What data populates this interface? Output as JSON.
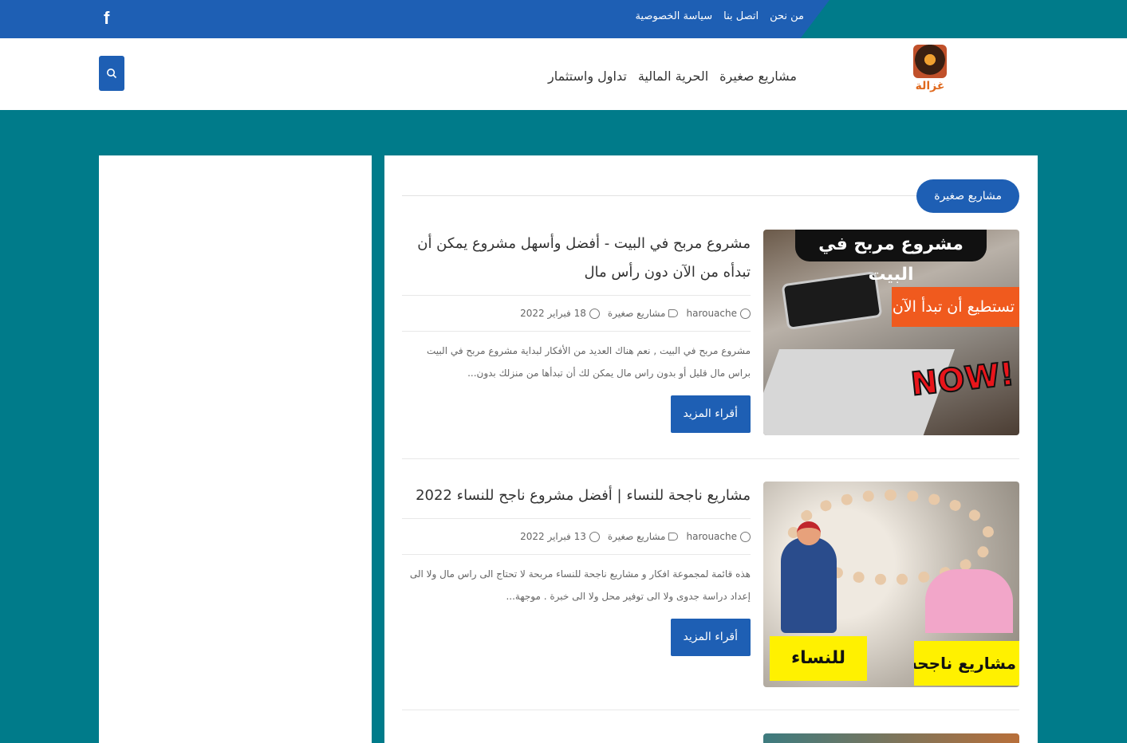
{
  "topbar": {
    "links": [
      "سياسة الخصوصية",
      "اتصل بنا",
      "من نحن"
    ],
    "social_icon": "facebook-icon"
  },
  "header": {
    "logo_text": "غزالة",
    "nav": [
      "مشاريع صغيرة",
      "الحرية المالية",
      "تداول واستثمار"
    ],
    "search_icon": "search-icon"
  },
  "colors": {
    "primary": "#1e5fb4",
    "background": "#007b8a",
    "accent": "#e06a1f"
  },
  "section": {
    "title": "مشاريع صغيرة"
  },
  "posts": [
    {
      "title": "مشروع مربح في البيت - أفضل وأسهل مشروع يمكن أن تبدأه من الآن دون رأس مال",
      "author": "harouache",
      "category": "مشاريع صغيرة",
      "date": "18 فبراير 2022",
      "excerpt": "مشروع مربح في البيت , نعم هناك العديد من الأفكار لبداية مشروع مربح في البيت براس مال قليل أو بدون راس مال يمكن لك أن تبدأها من منزلك بدون...",
      "read_more": "أقراء المزيد",
      "image": {
        "banner": "مشروع مربح في البيت",
        "orange": "تستطيع أن تبدأ الآن",
        "now": "NOW!"
      }
    },
    {
      "title": "مشاريع ناجحة للنساء | أفضل مشروع ناجح للنساء 2022",
      "author": "harouache",
      "category": "مشاريع صغيرة",
      "date": "13 فبراير 2022",
      "excerpt": "هذه قائمة لمجموعة افكار و مشاريع ناجحة للنساء مربحة لا تحتاج الى راس مال ولا الى إعداد دراسة جدوى ولا الى توفير محل ولا الى خبرة . موجهة...",
      "read_more": "أقراء المزيد",
      "image": {
        "label_left": "للنساء",
        "label_right": "مشاريع ناجحة"
      }
    }
  ]
}
